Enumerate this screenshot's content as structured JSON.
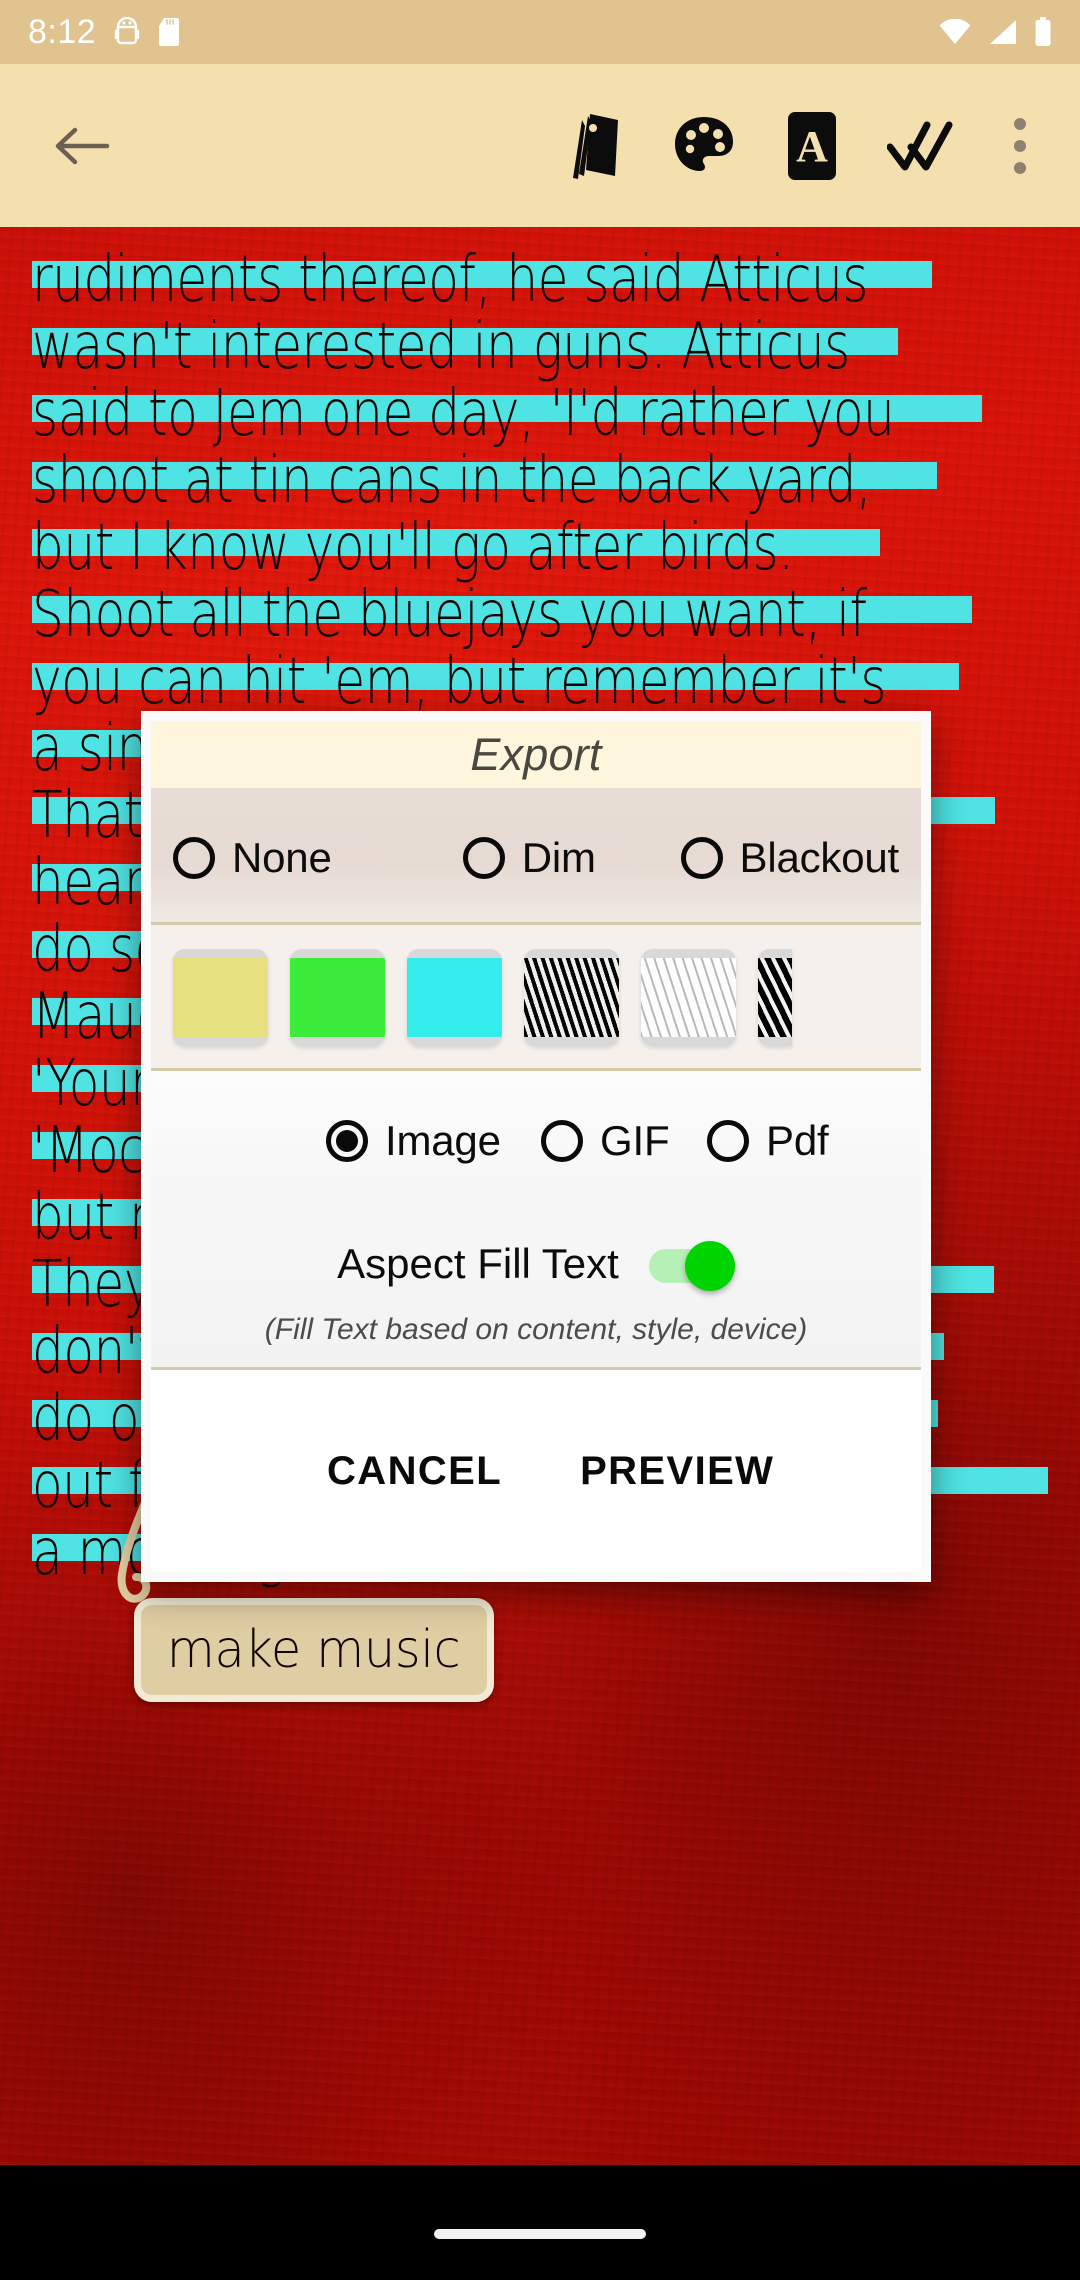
{
  "status_bar": {
    "clock": "8:12",
    "left_icons": [
      "android-debug-icon",
      "sd-card-icon"
    ],
    "right_icons": [
      "wifi-icon",
      "cellular-signal-icon",
      "battery-icon"
    ],
    "background": "#e0c38f"
  },
  "toolbar": {
    "background": "#f4dfaf",
    "back_icon": "back-arrow-icon",
    "actions": [
      {
        "name": "swatch-card-icon",
        "label": "Card"
      },
      {
        "name": "palette-icon",
        "label": "Palette"
      },
      {
        "name": "text-format-icon",
        "label": "A"
      },
      {
        "name": "double-check-icon",
        "label": "Select All"
      },
      {
        "name": "overflow-menu-icon",
        "label": "More options"
      }
    ]
  },
  "page": {
    "background_color": "#c60d06",
    "highlight_color": "#4fe3e3",
    "text_color": "#150603",
    "lines": [
      {
        "text": "rudiments thereof, he said Atticus",
        "hl_width": 900
      },
      {
        "text": "wasn't interested in guns. Atticus",
        "hl_width": 866
      },
      {
        "text": "said to Jem one day, 'I'd rather you",
        "hl_width": 950
      },
      {
        "text": "shoot at tin cans in the back yard,",
        "hl_width": 905
      },
      {
        "text": "but I know you'll go after birds.",
        "hl_width": 848
      },
      {
        "text": "Shoot all the bluejays you want, if",
        "hl_width": 940
      },
      {
        "text": "you can hit 'em, but remember it's",
        "hl_width": 927
      },
      {
        "text": "a sin to kill a mockingbird.'",
        "hl_width": 742
      },
      {
        "text": "That was the only time I ever heard",
        "hl_width": 963
      },
      {
        "text": "heard Atticus say it was a sin to",
        "hl_width": 880
      },
      {
        "text": "do something, and I asked Miss",
        "hl_width": 855
      },
      {
        "text": "Maudie about it.  'Your father's",
        "hl_width": 845
      },
      {
        "text": "'Your father's right,' she said.",
        "hl_width": 820
      },
      {
        "text": "'Mockingbirds don't do one thing",
        "hl_width": 884
      },
      {
        "text": "but make music for us to enjoy.",
        "hl_width": 858
      },
      {
        "text": "They don't eat up peoples gardens,",
        "hl_width": 962
      },
      {
        "text": "don't nest in corncribs, they don't",
        "hl_width": 912
      },
      {
        "text": "do one thing but sing their hearts",
        "hl_width": 906
      },
      {
        "text": "out for us. That's why it's a sin to kill",
        "hl_width": 1016
      },
      {
        "text": "a mockingbird.'",
        "hl_width": 466
      }
    ],
    "word_chip": "make music"
  },
  "dialog": {
    "title": "Export",
    "title_background": "#fdf6dc",
    "overlay_options": [
      {
        "label": "None",
        "selected": false
      },
      {
        "label": "Dim",
        "selected": false
      },
      {
        "label": "Blackout",
        "selected": false
      }
    ],
    "swatches": [
      {
        "name": "swatch-yellow",
        "color": "#e6e080",
        "type": "color"
      },
      {
        "name": "swatch-green",
        "color": "#3bec3b",
        "type": "color"
      },
      {
        "name": "swatch-cyan",
        "color": "#34ecec",
        "type": "color"
      },
      {
        "name": "swatch-pattern-dark",
        "color": "#000000",
        "type": "pattern"
      },
      {
        "name": "swatch-pattern-light",
        "color": "#d0d0d0",
        "type": "pattern"
      },
      {
        "name": "swatch-pattern-dark-2",
        "color": "#111111",
        "type": "pattern"
      }
    ],
    "format_options": [
      {
        "label": "Image",
        "selected": true
      },
      {
        "label": "GIF",
        "selected": false
      },
      {
        "label": "Pdf",
        "selected": false
      }
    ],
    "aspect_fill": {
      "label": "Aspect Fill Text",
      "enabled": true,
      "on_color": "#00d400",
      "subtitle": "(Fill Text based on content, style, device)"
    },
    "buttons": {
      "cancel": "CANCEL",
      "preview": "PREVIEW"
    }
  },
  "nav_bar": {
    "gesture_pill": "home-gesture-pill"
  }
}
